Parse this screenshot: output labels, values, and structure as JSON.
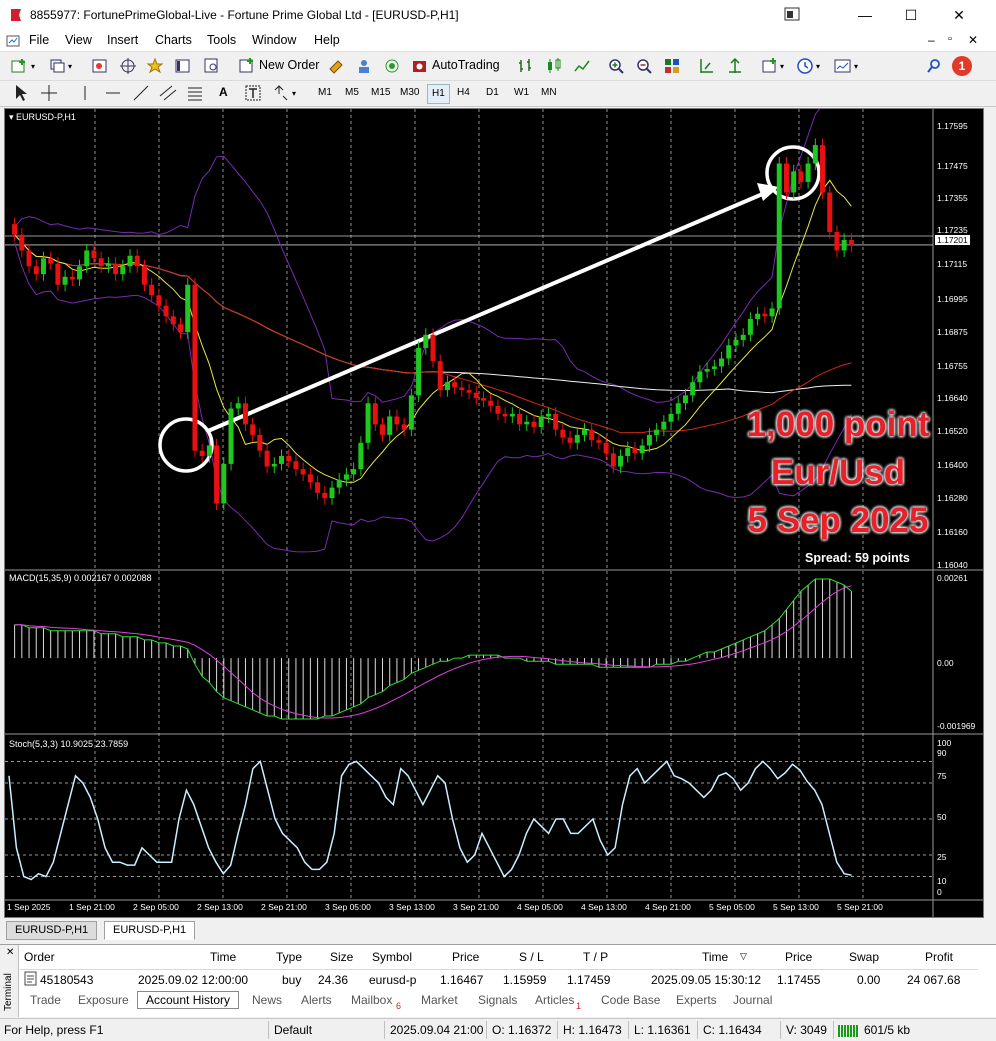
{
  "window": {
    "title": "8855977: FortunePrimeGlobal-Live - Fortune Prime Global Ltd - [EURUSD-P,H1]",
    "controls": [
      "—",
      "☐",
      "✕"
    ]
  },
  "menu": [
    "File",
    "View",
    "Insert",
    "Charts",
    "Tools",
    "Window",
    "Help"
  ],
  "toolbar": {
    "new_order": "New Order",
    "autotrading": "AutoTrading",
    "notification_count": "1"
  },
  "timeframes": [
    "M1",
    "M5",
    "M15",
    "M30",
    "H1",
    "H4",
    "D1",
    "W1",
    "MN"
  ],
  "selected_timeframe": "H1",
  "chart": {
    "symbol_label": "EURUSD-P,H1",
    "price_ticks": [
      "1.17595",
      "1.17475",
      "1.17355",
      "1.17235",
      "1.17115",
      "1.16995",
      "1.16875",
      "1.16755",
      "1.16640",
      "1.16520",
      "1.16400",
      "1.16280",
      "1.16160",
      "1.16040"
    ],
    "current_price": "1.17201",
    "macd_label": "MACD(15,35,9) 0.002167 0.002088",
    "macd_ticks": [
      "0.00261",
      "0.00",
      "-0.001969"
    ],
    "stoch_label": "Stoch(5,3,3) 10.9025 23.7859",
    "stoch_ticks": [
      "100",
      "90",
      "75",
      "50",
      "25",
      "10",
      "0"
    ],
    "time_labels": [
      "1 Sep 2025",
      "1 Sep 21:00",
      "2 Sep 05:00",
      "2 Sep 13:00",
      "2 Sep 21:00",
      "3 Sep 05:00",
      "3 Sep 13:00",
      "3 Sep 21:00",
      "4 Sep 05:00",
      "4 Sep 13:00",
      "4 Sep 21:00",
      "5 Sep 05:00",
      "5 Sep 13:00",
      "5 Sep 21:00"
    ],
    "overlay_line1": "1,000 point",
    "overlay_line2": "Eur/Usd",
    "overlay_line3": "5 Sep 2025",
    "spread": "Spread: 59 points",
    "overlay_color": "#e8202a"
  },
  "chart_tabs": [
    "EURUSD-P,H1",
    "EURUSD-P,H1"
  ],
  "terminal": {
    "side_label": "Terminal",
    "headers": [
      "Order",
      "Time",
      "Type",
      "Size",
      "Symbol",
      "Price",
      "S / L",
      "T / P",
      "Time",
      "Price",
      "Swap",
      "Profit"
    ],
    "row": [
      "45180543",
      "2025.09.02 12:00:00",
      "buy",
      "24.36",
      "eurusd-p",
      "1.16467",
      "1.15959",
      "1.17459",
      "2025.09.05 15:30:12",
      "1.17455",
      "0.00",
      "24 067.68"
    ],
    "tabs": [
      "Trade",
      "Exposure",
      "Account History",
      "News",
      "Alerts",
      "Mailbox",
      "Market",
      "Signals",
      "Articles",
      "Code Base",
      "Experts",
      "Journal"
    ],
    "mailbox_badge": "6",
    "articles_badge": "1",
    "active_tab": "Account History"
  },
  "status": {
    "help": "For Help, press F1",
    "profile": "Default",
    "datetime": "2025.09.04 21:00",
    "open": "O: 1.16372",
    "high": "H: 1.16473",
    "low": "L: 1.16361",
    "close": "C: 1.16434",
    "volume": "V: 3049",
    "traffic": "601/5 kb"
  },
  "chart_data": {
    "type": "candlestick",
    "price_range": [
      1.1599,
      1.1766
    ],
    "closes": [
      1.1724,
      1.1718,
      1.1712,
      1.1709,
      1.1715,
      1.1713,
      1.1705,
      1.1708,
      1.1707,
      1.1712,
      1.1718,
      1.1715,
      1.1712,
      1.1713,
      1.1709,
      1.1712,
      1.1716,
      1.1712,
      1.1705,
      1.1701,
      1.1697,
      1.1693,
      1.169,
      1.1687,
      1.1705,
      1.1642,
      1.164,
      1.1644,
      1.1622,
      1.1637,
      1.1658,
      1.166,
      1.1652,
      1.1648,
      1.1642,
      1.1636,
      1.1637,
      1.164,
      1.1638,
      1.1635,
      1.1633,
      1.163,
      1.1626,
      1.1624,
      1.1628,
      1.1631,
      1.1633,
      1.1635,
      1.1645,
      1.166,
      1.1652,
      1.1648,
      1.1655,
      1.1652,
      1.165,
      1.1663,
      1.1681,
      1.1686,
      1.1676,
      1.1665,
      1.1668,
      1.1666,
      1.1665,
      1.1664,
      1.1662,
      1.1661,
      1.1659,
      1.1656,
      1.1655,
      1.1656,
      1.1652,
      1.1653,
      1.1651,
      1.1655,
      1.1656,
      1.165,
      1.1647,
      1.1645,
      1.1648,
      1.165,
      1.1646,
      1.1645,
      1.1641,
      1.1636,
      1.164,
      1.1643,
      1.1641,
      1.1644,
      1.1648,
      1.165,
      1.1653,
      1.1656,
      1.166,
      1.1663,
      1.1668,
      1.1672,
      1.1673,
      1.1674,
      1.1677,
      1.1682,
      1.1684,
      1.1686,
      1.1692,
      1.1694,
      1.1693,
      1.1696,
      1.1751,
      1.174,
      1.1748,
      1.1744,
      1.1751,
      1.1758,
      1.174,
      1.1725,
      1.1718,
      1.1722,
      1.172
    ],
    "macd_hist": [
      0.0011,
      0.0011,
      0.001,
      0.001,
      0.001,
      0.0009,
      0.0009,
      0.0009,
      0.0009,
      0.0009,
      0.0009,
      0.0009,
      0.0008,
      0.0008,
      0.0008,
      0.0007,
      0.0007,
      0.0007,
      0.0006,
      0.0006,
      0.0005,
      0.0005,
      0.0004,
      0.0004,
      0.0003,
      -0.0002,
      -0.0006,
      -0.0008,
      -0.0011,
      -0.0013,
      -0.0014,
      -0.0015,
      -0.0016,
      -0.0017,
      -0.0018,
      -0.0019,
      -0.0019,
      -0.002,
      -0.002,
      -0.002,
      -0.002,
      -0.002,
      -0.002,
      -0.0019,
      -0.0019,
      -0.0018,
      -0.0017,
      -0.0016,
      -0.0015,
      -0.0013,
      -0.0012,
      -0.0011,
      -0.0009,
      -0.0008,
      -0.0007,
      -0.0005,
      -0.0004,
      -0.0003,
      -0.0002,
      -0.0001,
      -0.0001,
      0.0,
      0.0,
      0.0001,
      0.0001,
      0.0001,
      0.0001,
      0.0001,
      0.0,
      0.0,
      0.0,
      -0.0001,
      -0.0001,
      -0.0001,
      -0.0001,
      -0.0002,
      -0.0002,
      -0.0002,
      -0.0002,
      -0.0002,
      -0.0002,
      -0.0003,
      -0.0003,
      -0.0003,
      -0.0003,
      -0.0003,
      -0.0003,
      -0.0003,
      -0.0003,
      -0.0002,
      -0.0002,
      -0.0002,
      -0.0001,
      -0.0001,
      0.0,
      0.0001,
      0.0002,
      0.0002,
      0.0003,
      0.0004,
      0.0005,
      0.0006,
      0.0007,
      0.0008,
      0.0009,
      0.0011,
      0.0013,
      0.0016,
      0.0019,
      0.0022,
      0.0024,
      0.0026,
      0.0026,
      0.0026,
      0.0025,
      0.0024,
      0.0022
    ],
    "stoch_k": [
      80,
      30,
      10,
      8,
      12,
      10,
      20,
      40,
      60,
      80,
      75,
      65,
      50,
      30,
      20,
      20,
      18,
      18,
      30,
      25,
      20,
      20,
      20,
      50,
      70,
      60,
      45,
      30,
      20,
      12,
      18,
      40,
      60,
      85,
      90,
      70,
      50,
      40,
      35,
      30,
      20,
      15,
      15,
      20,
      40,
      80,
      88,
      90,
      85,
      80,
      75,
      65,
      60,
      85,
      80,
      70,
      60,
      70,
      80,
      75,
      50,
      30,
      20,
      25,
      40,
      30,
      20,
      10,
      15,
      25,
      40,
      50,
      45,
      40,
      50,
      50,
      40,
      40,
      45,
      50,
      35,
      25,
      30,
      60,
      80,
      85,
      75,
      80,
      85,
      90,
      80,
      78,
      75,
      70,
      65,
      70,
      80,
      82,
      78,
      70,
      75,
      85,
      90,
      85,
      78,
      82,
      88,
      84,
      76,
      70,
      60,
      40,
      20,
      12,
      11
    ],
    "stoch_d": [
      75,
      40,
      15,
      9,
      11,
      11,
      17,
      33,
      53,
      72,
      77,
      70,
      58,
      38,
      23,
      20,
      19,
      19,
      25,
      26,
      22,
      21,
      20,
      40,
      60,
      63,
      52,
      35,
      22,
      14,
      16,
      34,
      55,
      78,
      87,
      75,
      57,
      45,
      38,
      33,
      23,
      18,
      16,
      18,
      32,
      70,
      85,
      89,
      86,
      82,
      77,
      68,
      62,
      78,
      80,
      73,
      63,
      67,
      76,
      76,
      55,
      35,
      22,
      23,
      35,
      32,
      22,
      12,
      13,
      22,
      35,
      46,
      46,
      42,
      47,
      49,
      43,
      41,
      43,
      47,
      38,
      28,
      29,
      53,
      73,
      83,
      78,
      79,
      83,
      88,
      82,
      79,
      76,
      72,
      67,
      68,
      77,
      81,
      79,
      72,
      74,
      82,
      88,
      86,
      80,
      81,
      86,
      85,
      78,
      72,
      62,
      44,
      24,
      14,
      12
    ]
  }
}
